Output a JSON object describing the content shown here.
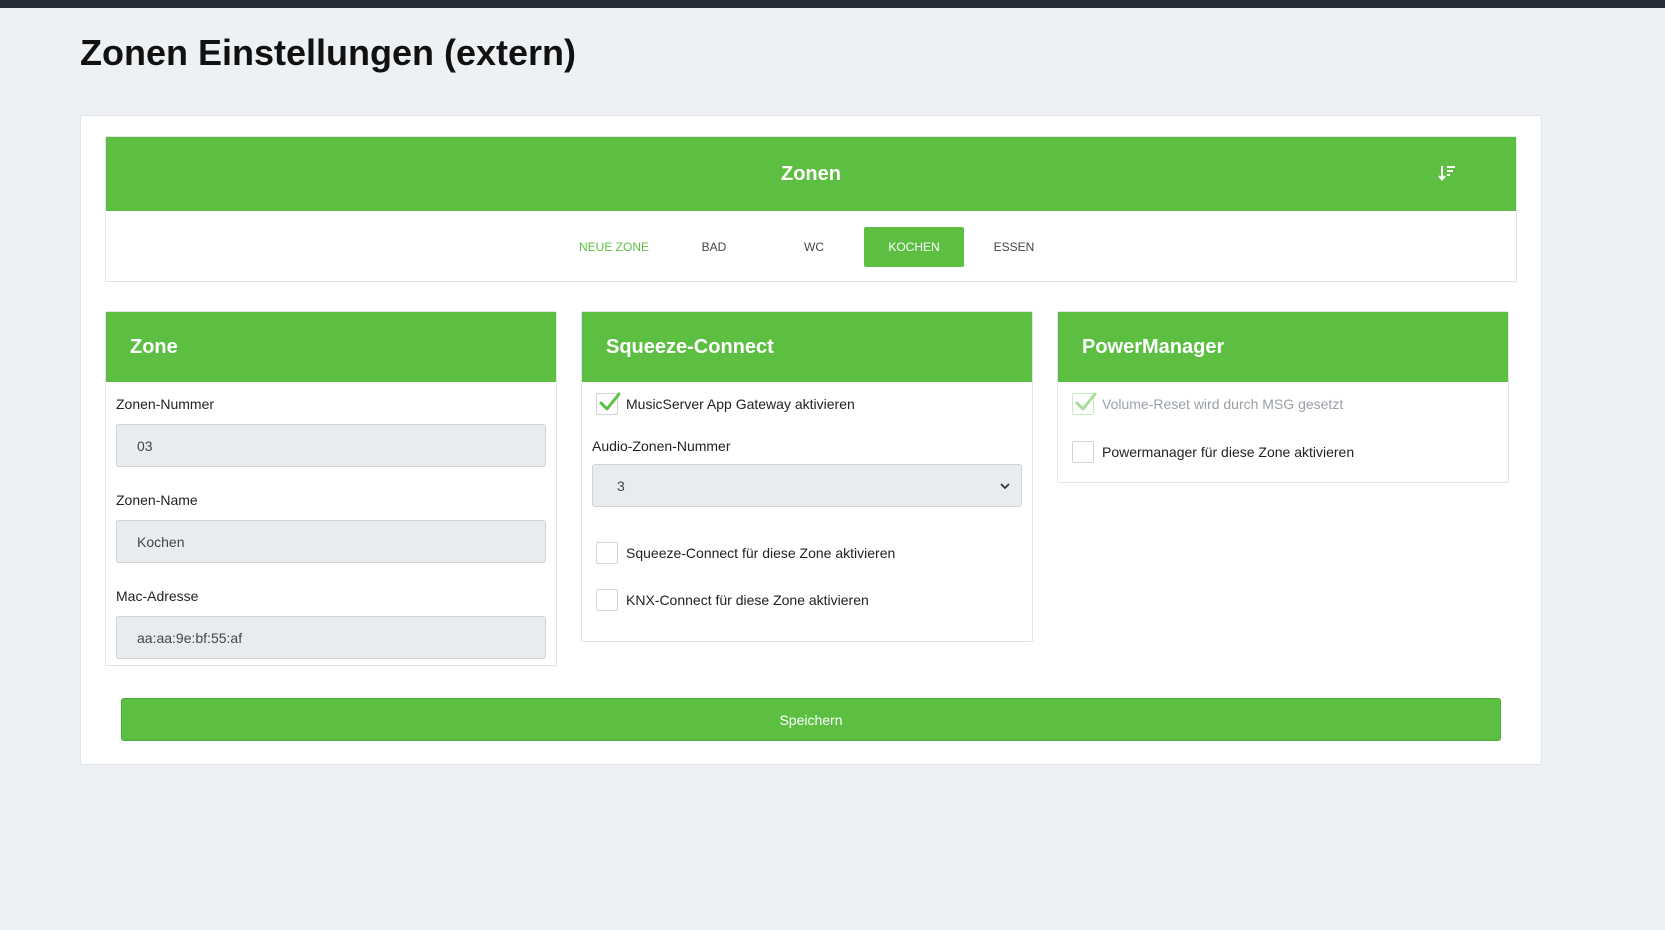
{
  "page": {
    "title": "Zonen Einstellungen (extern)"
  },
  "zones": {
    "title": "Zonen",
    "sort_icon": "sort-descending-icon",
    "tabs": [
      "NEUE ZONE",
      "BAD",
      "WC",
      "KOCHEN",
      "ESSEN"
    ],
    "active_tab": "KOCHEN"
  },
  "zone_panel": {
    "title": "Zone",
    "number_label": "Zonen-Nummer",
    "number_value": "03",
    "name_label": "Zonen-Name",
    "name_value": "Kochen",
    "mac_label": "Mac-Adresse",
    "mac_value": "aa:aa:9e:bf:55:af"
  },
  "squeeze_panel": {
    "title": "Squeeze-Connect",
    "gateway_label": "MusicServer App Gateway aktivieren",
    "gateway_checked": true,
    "audio_label": "Audio-Zonen-Nummer",
    "audio_value": "3",
    "squeeze_label": "Squeeze-Connect für diese Zone aktivieren",
    "squeeze_checked": false,
    "knx_label": "KNX-Connect für diese Zone aktivieren",
    "knx_checked": false
  },
  "power_panel": {
    "title": "PowerManager",
    "volume_reset_label": "Volume-Reset wird durch MSG gesetzt",
    "volume_reset_checked": true,
    "powermanager_label": "Powermanager für diese Zone aktivieren",
    "powermanager_checked": false
  },
  "save_label": "Speichern",
  "colors": {
    "accent": "#5cbf42",
    "topbar": "#252d38",
    "background": "#eef1f4"
  }
}
